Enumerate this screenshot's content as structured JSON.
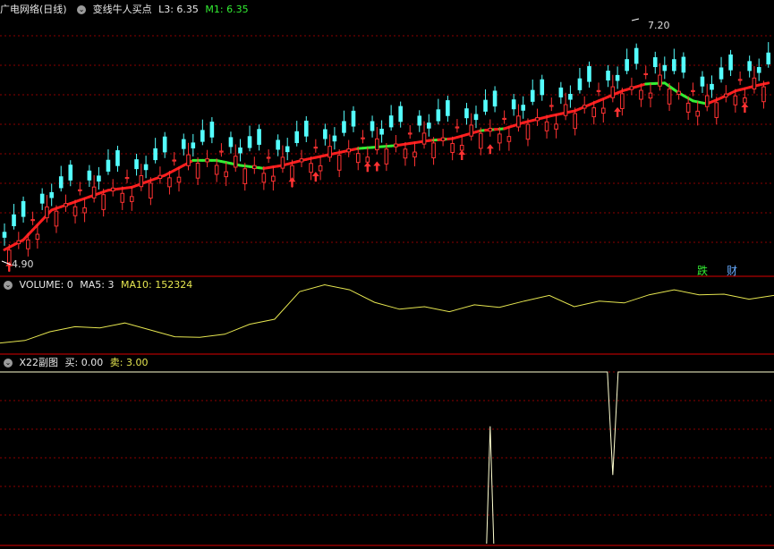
{
  "main_header": {
    "symbol": "广电网络(日线)",
    "indicator": "变线牛人买点",
    "l3_label": "L3: 6.35",
    "m1_label": "M1: 6.35"
  },
  "volume_header": {
    "name": "VOLUME: 0",
    "ma5": "MA5: 3",
    "ma10": "MA10: 152324"
  },
  "sub_header": {
    "name": "X22副图",
    "buy": "买: 0.00",
    "sell": "卖: 3.00"
  },
  "colors": {
    "background": "#000000",
    "up_candle": "#ff3232",
    "down_candle": "#54ffff",
    "ma_up": "#ff1e1e",
    "ma_down": "#33ee33",
    "volume_line": "#e6e650",
    "signal_line": "#ffffd0",
    "grid": "#8b0000",
    "separator": "#b00000"
  },
  "chart_data": [
    {
      "type": "candlestick",
      "name": "price",
      "marker_texts": {
        "high": "7.20",
        "low": "4.90"
      },
      "tags": [
        {
          "text": "跌",
          "color": "#33ee33"
        },
        {
          "text": "财",
          "color": "#66aaff"
        }
      ],
      "anchors": [
        [
          0,
          5.0
        ],
        [
          4,
          5.1
        ],
        [
          10,
          5.4
        ],
        [
          22,
          5.6
        ],
        [
          27,
          5.63
        ],
        [
          34,
          5.75
        ],
        [
          40,
          5.9
        ],
        [
          45,
          5.9
        ],
        [
          50,
          5.85
        ],
        [
          55,
          5.82
        ],
        [
          59,
          5.85
        ],
        [
          63,
          5.9
        ],
        [
          68,
          5.95
        ],
        [
          71,
          5.98
        ],
        [
          75,
          6.02
        ],
        [
          83,
          6.05
        ],
        [
          90,
          6.1
        ],
        [
          95,
          6.12
        ],
        [
          101,
          6.2
        ],
        [
          106,
          6.22
        ],
        [
          110,
          6.28
        ],
        [
          116,
          6.35
        ],
        [
          121,
          6.4
        ],
        [
          126,
          6.5
        ],
        [
          131,
          6.6
        ],
        [
          136,
          6.67
        ],
        [
          140,
          6.68
        ],
        [
          143,
          6.58
        ],
        [
          146,
          6.5
        ],
        [
          149,
          6.47
        ],
        [
          152,
          6.53
        ],
        [
          155,
          6.6
        ],
        [
          160,
          6.66
        ],
        [
          162,
          6.68
        ]
      ],
      "close_offsets": [
        0.03,
        -0.04,
        0.06,
        -0.02,
        0.08,
        -0.05,
        0.02,
        -0.07,
        0.05,
        0.01
      ],
      "buy_arrow_days": [
        1,
        61,
        66,
        77,
        79,
        97,
        103,
        130,
        157
      ],
      "ylim": [
        4.85,
        7.3
      ]
    },
    {
      "type": "line",
      "name": "MA",
      "up_color": "#ff1e1e",
      "down_color": "#33ee33"
    },
    {
      "type": "line",
      "name": "VOLUME",
      "values": [
        0.12,
        0.16,
        0.3,
        0.38,
        0.36,
        0.44,
        0.33,
        0.22,
        0.21,
        0.26,
        0.42,
        0.5,
        0.94,
        1.05,
        0.97,
        0.77,
        0.66,
        0.7,
        0.62,
        0.73,
        0.69,
        0.79,
        0.88,
        0.7,
        0.79,
        0.76,
        0.89,
        0.97,
        0.89,
        0.9,
        0.82,
        0.88
      ]
    },
    {
      "type": "line",
      "name": "X22",
      "baseline_value": 3,
      "floor_value": 0,
      "spikes": [
        {
          "day": 129,
          "to": 1.2,
          "direction": "down"
        },
        {
          "day": 103,
          "to": 2.05,
          "direction": "up"
        }
      ]
    }
  ]
}
